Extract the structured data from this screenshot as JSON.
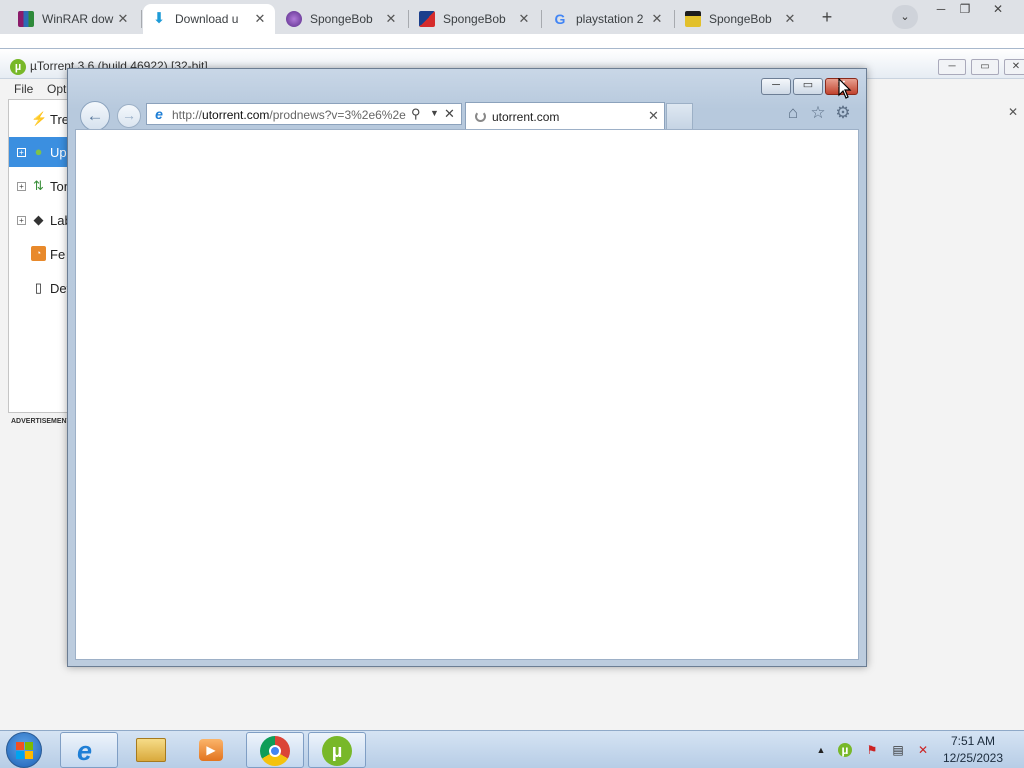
{
  "chrome": {
    "tabs": [
      {
        "title": "WinRAR dow",
        "icon": "winrar-icon",
        "active": false
      },
      {
        "title": "Download u",
        "icon": "download-arrow-icon",
        "active": true
      },
      {
        "title": "SpongeBob",
        "icon": "spongebob-game-icon",
        "active": false
      },
      {
        "title": "SpongeBob",
        "icon": "spongebob-tv-icon",
        "active": false
      },
      {
        "title": "playstation 2",
        "icon": "google-icon",
        "active": false
      },
      {
        "title": "SpongeBob",
        "icon": "spongebob-bag-icon",
        "active": false
      }
    ],
    "new_tab": "+",
    "tab_search": "⌄"
  },
  "utorrent": {
    "title": "µTorrent 3.6  (build 46922) [32-bit]",
    "menu": [
      "File",
      "Opti"
    ],
    "sidebar": [
      {
        "label": "Tre",
        "icon": "bolt-icon",
        "selected": false,
        "expandable": false
      },
      {
        "label": "Up",
        "icon": "globe-icon",
        "selected": true,
        "expandable": true
      },
      {
        "label": "Tor",
        "icon": "transfer-arrows-icon",
        "selected": false,
        "expandable": true
      },
      {
        "label": "Lab",
        "icon": "tag-icon",
        "selected": false,
        "expandable": true
      },
      {
        "label": "Fe",
        "icon": "rss-icon",
        "selected": false,
        "expandable": false
      },
      {
        "label": "Dev",
        "icon": "device-icon",
        "selected": false,
        "expandable": false
      }
    ],
    "advertisement_label": "ADVERTISEMENT"
  },
  "ie": {
    "url_prefix": "http://",
    "url_host": "utorrent.com",
    "url_rest": "/prodnews?v=3%2e6%2e",
    "tab_title": "utorrent.com"
  },
  "taskbar": {
    "time": "7:51 AM",
    "date": "12/25/2023",
    "pinned": [
      "internet-explorer-icon",
      "file-explorer-icon",
      "media-player-icon",
      "chrome-icon",
      "utorrent-icon"
    ]
  },
  "colors": {
    "selection": "#3b8fe0",
    "utorrent_green": "#78b829",
    "ie_close": "#c1432e"
  }
}
